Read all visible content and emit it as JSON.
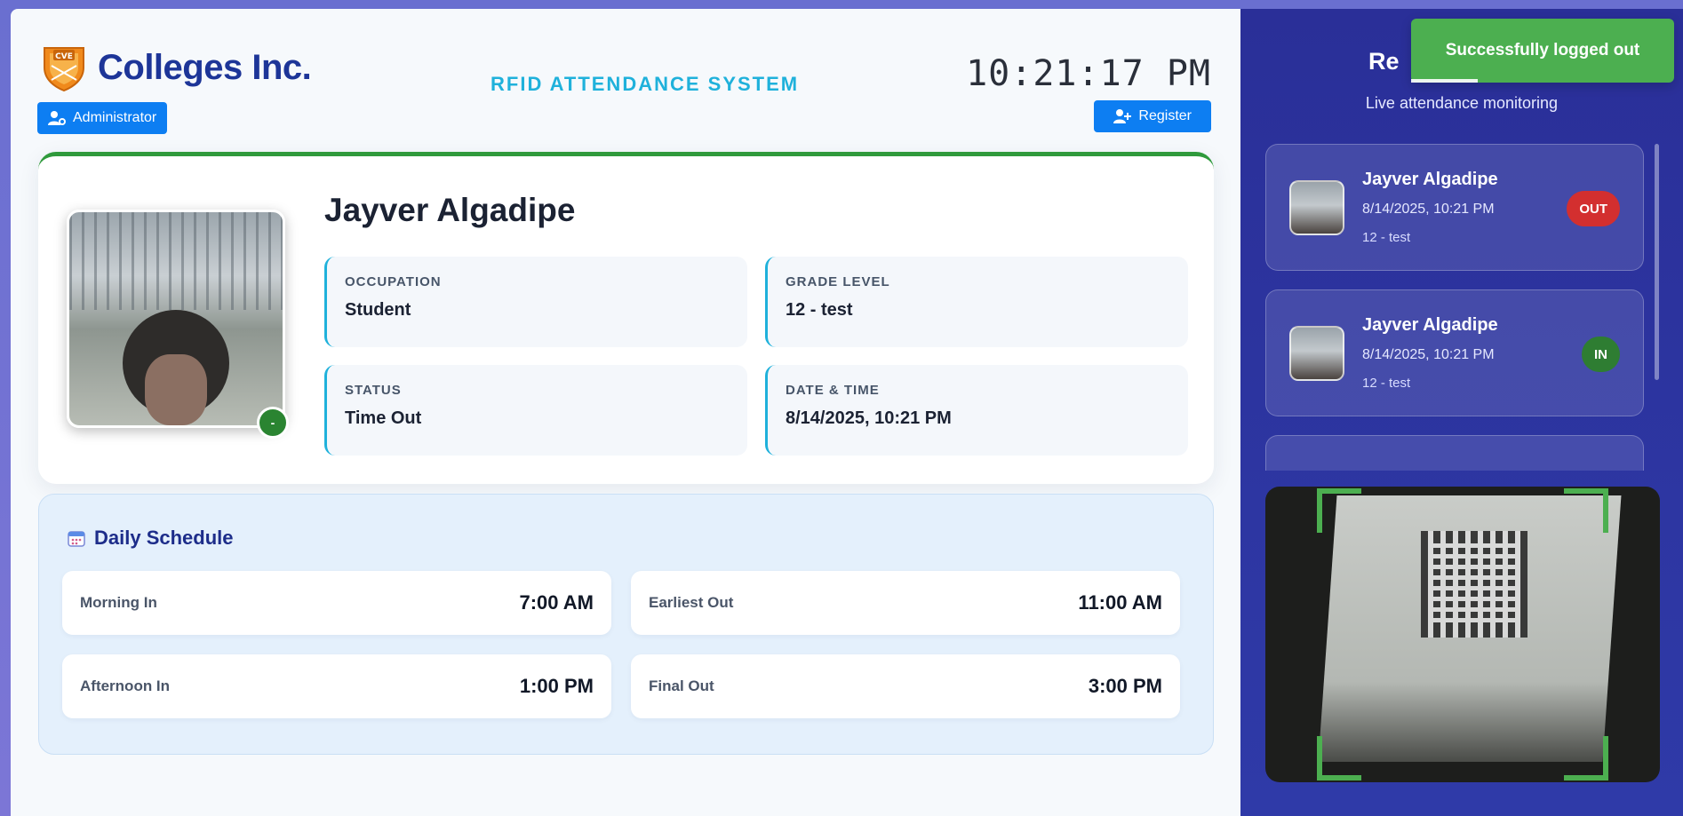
{
  "brand": {
    "name": "Colleges Inc.",
    "logo_text": "CVE"
  },
  "header": {
    "system_title": "RFID ATTENDANCE SYSTEM",
    "clock": "10:21:17 PM",
    "admin_label": "Administrator",
    "register_label": "Register",
    "progress": 0.49
  },
  "profile": {
    "name": "Jayver Algadipe",
    "badge": "-",
    "occupation_label": "OCCUPATION",
    "occupation": "Student",
    "grade_label": "GRADE LEVEL",
    "grade": "12 - test",
    "status_label": "STATUS",
    "status": "Time Out",
    "datetime_label": "DATE & TIME",
    "datetime": "8/14/2025, 10:21 PM"
  },
  "schedule": {
    "title": "Daily Schedule",
    "items": [
      {
        "label": "Morning In",
        "time": "7:00 AM"
      },
      {
        "label": "Earliest Out",
        "time": "11:00 AM"
      },
      {
        "label": "Afternoon In",
        "time": "1:00 PM"
      },
      {
        "label": "Final Out",
        "time": "3:00 PM"
      }
    ]
  },
  "side": {
    "title": "Re",
    "subtitle": "Live attendance monitoring",
    "feed": [
      {
        "name": "Jayver Algadipe",
        "time": "8/14/2025, 10:21 PM",
        "grade": "12 - test",
        "status": "OUT"
      },
      {
        "name": "Jayver Algadipe",
        "time": "8/14/2025, 10:21 PM",
        "grade": "12 - test",
        "status": "IN"
      }
    ]
  },
  "toast": {
    "message": "Successfully logged out"
  },
  "colors": {
    "accent": "#0d7ef2",
    "success": "#4caf50",
    "danger": "#d32f2f",
    "brand": "#1d3598"
  }
}
